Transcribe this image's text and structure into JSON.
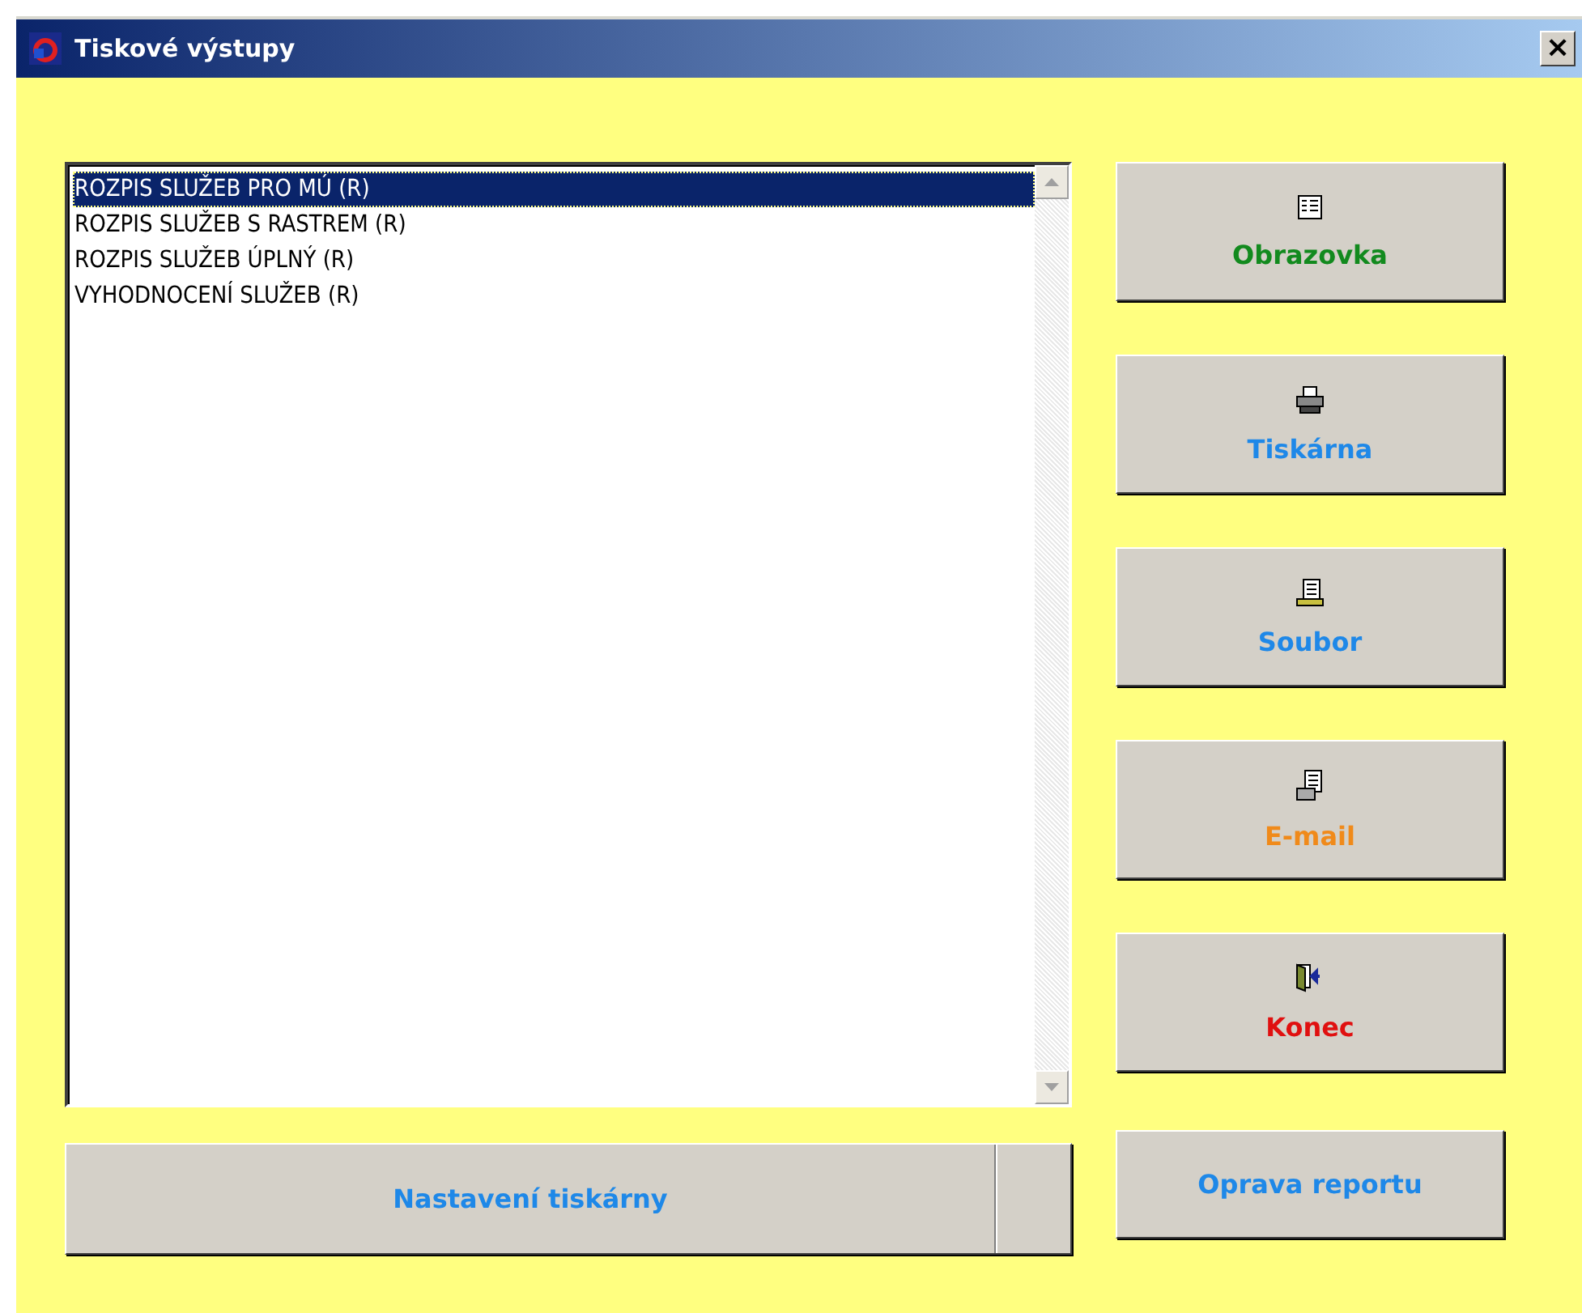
{
  "window": {
    "title": "Tiskové výstupy",
    "close": "×"
  },
  "report_list": {
    "items": [
      {
        "label": "ROZPIS SLUŽEB PRO MÚ (R)",
        "selected": true
      },
      {
        "label": "ROZPIS SLUŽEB S RASTREM (R)",
        "selected": false
      },
      {
        "label": "ROZPIS SLUŽEB ÚPLNÝ (R)",
        "selected": false
      },
      {
        "label": "VYHODNOCENÍ SLUŽEB (R)",
        "selected": false
      }
    ]
  },
  "output_buttons": [
    {
      "label": "Obrazovka",
      "kind": "screen",
      "color": "#128a1e"
    },
    {
      "label": "Tiskárna",
      "kind": "printer",
      "color": "#1e88e8"
    },
    {
      "label": "Soubor",
      "kind": "file",
      "color": "#1e88e8"
    },
    {
      "label": "E-mail",
      "kind": "email",
      "color": "#f08a1a"
    },
    {
      "label": "Konec",
      "kind": "exit",
      "color": "#e01010"
    }
  ],
  "bottom_buttons": [
    {
      "label": "Nastavení tiskárny",
      "color": "#1e88e8"
    },
    {
      "label": "Oprava reportu",
      "color": "#1e88e8"
    }
  ]
}
